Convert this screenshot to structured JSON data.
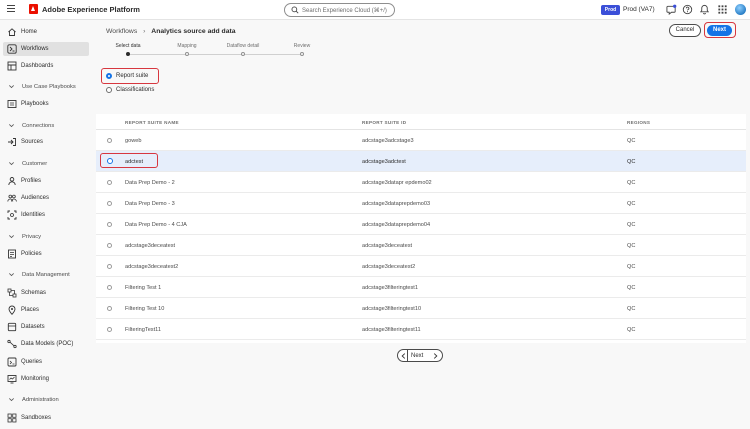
{
  "app": {
    "brand": "Adobe Experience Platform",
    "search_placeholder": "Search Experience Cloud (⌘+/)",
    "env_badge": "Prod",
    "env_label": "Prod (VA7)"
  },
  "sidebar": {
    "home": "Home",
    "workflows": "Workflows",
    "dashboards": "Dashboards",
    "use_case_playbooks": "Use Case Playbooks",
    "playbooks": "Playbooks",
    "connections": "Connections",
    "sources": "Sources",
    "customer": "Customer",
    "profiles": "Profiles",
    "audiences": "Audiences",
    "identities": "Identities",
    "privacy": "Privacy",
    "policies": "Policies",
    "data_management": "Data Management",
    "schemas": "Schemas",
    "places": "Places",
    "datasets": "Datasets",
    "data_models": "Data Models (POC)",
    "queries": "Queries",
    "monitoring": "Monitoring",
    "administration": "Administration",
    "sandboxes": "Sandboxes"
  },
  "header": {
    "breadcrumb_root": "Workflows",
    "breadcrumb_separator": "›",
    "title": "Analytics source add data",
    "cancel_label": "Cancel",
    "next_label": "Next"
  },
  "steps": [
    "Select data",
    "Mapping",
    "Dataflow detail",
    "Review"
  ],
  "source_type": {
    "option1": "Report suite",
    "option2": "Classifications",
    "selected": "Report suite"
  },
  "table": {
    "headers": {
      "name": "REPORT SUITE NAME",
      "id": "REPORT SUITE ID",
      "regions": "REGIONS"
    },
    "rows": [
      {
        "name": "goweb",
        "id": "adcstage3adcstage3",
        "region": "QC",
        "selected": false
      },
      {
        "name": "adctest",
        "id": "adcstage3adctest",
        "region": "QC",
        "selected": true
      },
      {
        "name": "Data Prep Demo - 2",
        "id": "adcstage3datapr epdemo02",
        "region": "QC",
        "selected": false
      },
      {
        "name": "Data Prep Demo - 3",
        "id": "adcstage3dataprepdemo03",
        "region": "QC",
        "selected": false
      },
      {
        "name": "Data Prep Demo - 4 CJA",
        "id": "adcstage3dataprepdemo04",
        "region": "QC",
        "selected": false
      },
      {
        "name": "adcstage3deceatest",
        "id": "adcstage3deceatest",
        "region": "QC",
        "selected": false
      },
      {
        "name": "adcstage3deceatest2",
        "id": "adcstage3deceatest2",
        "region": "QC",
        "selected": false
      },
      {
        "name": "Filtering Test 1",
        "id": "adcstage3filteringtest1",
        "region": "QC",
        "selected": false
      },
      {
        "name": "Filtering Test 10",
        "id": "adcstage3filteringtest10",
        "region": "QC",
        "selected": false
      },
      {
        "name": "FilteringTest11",
        "id": "adcstage3filteringtest11",
        "region": "QC",
        "selected": false
      }
    ]
  },
  "pagination": {
    "next_label": "Next"
  }
}
